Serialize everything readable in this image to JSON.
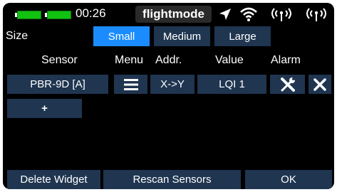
{
  "status": {
    "time": "00:26",
    "model_name": "flightmode",
    "icons": [
      "battery-tx-icon",
      "battery-rx-icon",
      "gps-arrow-icon",
      "wifi-icon",
      "antenna-icon",
      "antenna-icon"
    ],
    "accent_color": "#1a8cff",
    "battery_color": "#11c211"
  },
  "size": {
    "label": "Size",
    "options": [
      "Small",
      "Medium",
      "Large"
    ],
    "selected": "Small"
  },
  "table": {
    "headers": {
      "sensor": "Sensor",
      "menu": "Menu",
      "addr": "Addr.",
      "value": "Value",
      "alarm": "Alarm"
    },
    "rows": [
      {
        "sensor": "PBR-9D [A]",
        "menu_icon": "menu-icon",
        "addr": "X->Y",
        "value": "LQI 1",
        "alarm_icon": "wrench-icon",
        "delete_icon": "close-icon"
      }
    ],
    "add_label": "+"
  },
  "footer": {
    "delete_widget": "Delete Widget",
    "rescan_sensors": "Rescan Sensors",
    "ok": "OK"
  }
}
